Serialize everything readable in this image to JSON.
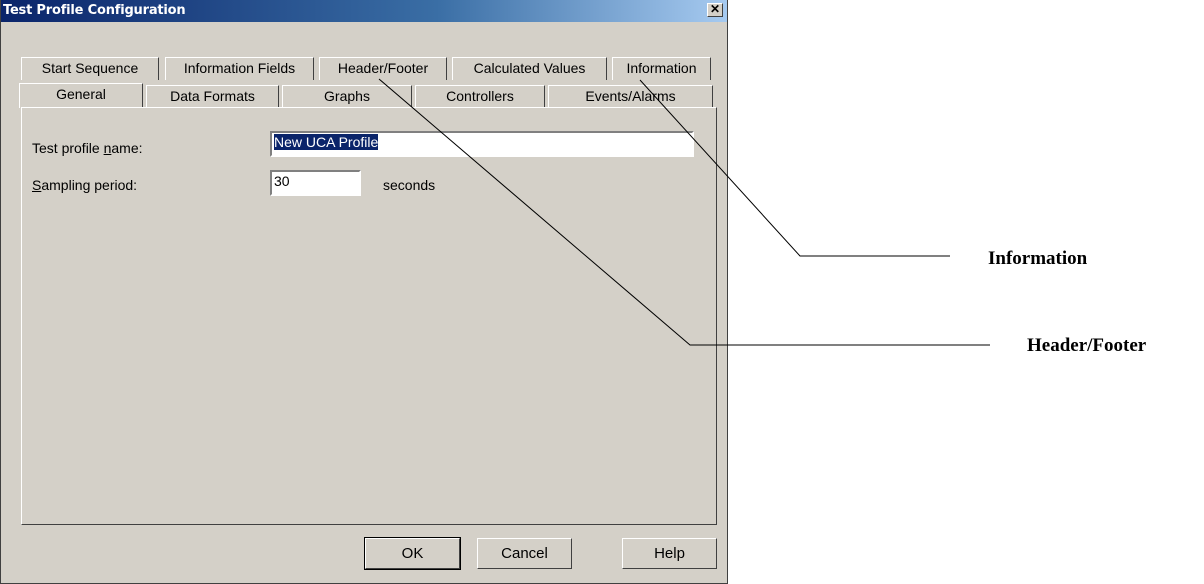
{
  "window": {
    "title": "Test Profile Configuration",
    "close_symbol": "✕"
  },
  "tabs": {
    "row_back": [
      "Start Sequence",
      "Information Fields",
      "Header/Footer",
      "Calculated Values",
      "Information"
    ],
    "row_front": [
      "General",
      "Data Formats",
      "Graphs",
      "Controllers",
      "Events/Alarms"
    ],
    "selected": "General"
  },
  "general": {
    "name_label_pre": "Test profile ",
    "name_label_mnemonic": "n",
    "name_label_post": "ame:",
    "name_value": "New UCA Profile",
    "sampling_label_mnemonic": "S",
    "sampling_label_post": "ampling period:",
    "sampling_value": "30",
    "sampling_unit": "seconds"
  },
  "buttons": {
    "ok": "OK",
    "cancel": "Cancel",
    "help": "Help"
  },
  "callouts": {
    "information": "Information",
    "header_footer": "Header/Footer"
  }
}
